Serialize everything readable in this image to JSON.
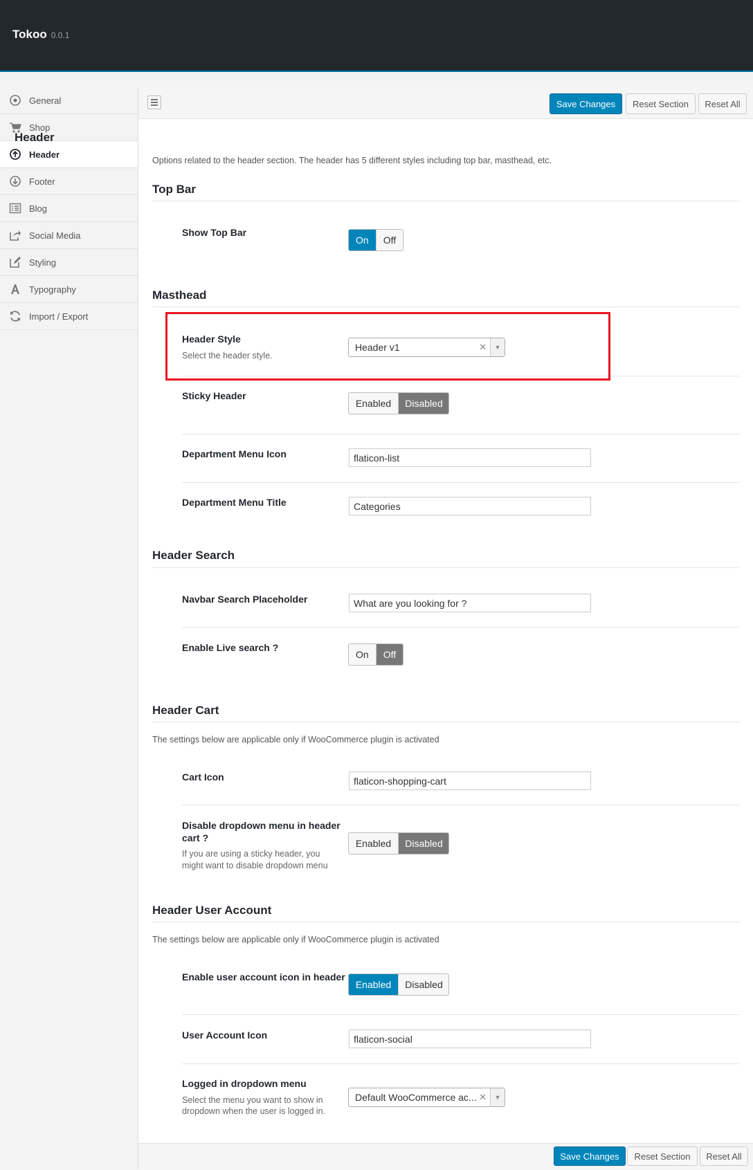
{
  "app": {
    "name": "Tokoo",
    "version": "0.0.1"
  },
  "sidebar": {
    "items": [
      {
        "label": "General",
        "icon": "circle-dot-icon",
        "active": false
      },
      {
        "label": "Shop",
        "icon": "shopping-cart-icon",
        "active": false
      },
      {
        "label": "Header",
        "icon": "arrow-up-circle-icon",
        "active": true
      },
      {
        "label": "Footer",
        "icon": "arrow-down-circle-icon",
        "active": false
      },
      {
        "label": "Blog",
        "icon": "list-icon",
        "active": false
      },
      {
        "label": "Social Media",
        "icon": "share-icon",
        "active": false
      },
      {
        "label": "Styling",
        "icon": "edit-icon",
        "active": false
      },
      {
        "label": "Typography",
        "icon": "font-icon",
        "active": false
      },
      {
        "label": "Import / Export",
        "icon": "refresh-icon",
        "active": false
      }
    ]
  },
  "actions": {
    "save": "Save Changes",
    "reset_section": "Reset Section",
    "reset_all": "Reset All"
  },
  "header_section": {
    "title": "Header",
    "description": "Options related to the header section. The header has 5 different styles including top bar, masthead, etc."
  },
  "top_bar": {
    "title": "Top Bar",
    "show_top_bar": {
      "label": "Show Top Bar",
      "on": "On",
      "off": "Off",
      "selected": "On"
    }
  },
  "masthead": {
    "title": "Masthead",
    "header_style": {
      "label": "Header Style",
      "description": "Select the header style.",
      "value": "Header v1"
    },
    "sticky_header": {
      "label": "Sticky Header",
      "enabled": "Enabled",
      "disabled": "Disabled",
      "selected": "Disabled"
    },
    "department_menu_icon": {
      "label": "Department Menu Icon",
      "value": "flaticon-list"
    },
    "department_menu_title": {
      "label": "Department Menu Title",
      "value": "Categories"
    }
  },
  "header_search": {
    "title": "Header Search",
    "placeholder_field": {
      "label": "Navbar Search Placeholder",
      "value": "What are you looking for ?"
    },
    "live_search": {
      "label": "Enable Live search ?",
      "on": "On",
      "off": "Off",
      "selected": "Off"
    }
  },
  "header_cart": {
    "title": "Header Cart",
    "description": "The settings below are applicable only if WooCommerce plugin is activated",
    "cart_icon": {
      "label": "Cart Icon",
      "value": "flaticon-shopping-cart"
    },
    "disable_dropdown": {
      "label_line1": "Disable dropdown menu in header",
      "label_line2": "cart ?",
      "desc_line1": "If you are using a sticky header, you",
      "desc_line2": "might want to disable dropdown menu",
      "enabled": "Enabled",
      "disabled": "Disabled",
      "selected": "Disabled"
    }
  },
  "header_user_account": {
    "title": "Header User Account",
    "description": "The settings below are applicable only if WooCommerce plugin is activated",
    "enable_icon": {
      "label": "Enable user account icon in header ?",
      "enabled": "Enabled",
      "disabled": "Disabled",
      "selected": "Enabled"
    },
    "user_account_icon": {
      "label": "User Account Icon",
      "value": "flaticon-social"
    },
    "logged_in_dropdown": {
      "label": "Logged in dropdown menu",
      "desc_line1": "Select the menu you want to show in",
      "desc_line2": "dropdown when the user is logged in.",
      "value": "Default WooCommerce ac..."
    }
  },
  "colors": {
    "accent": "#0085ba",
    "topbar": "#23282d",
    "highlight": "#e8131f"
  }
}
